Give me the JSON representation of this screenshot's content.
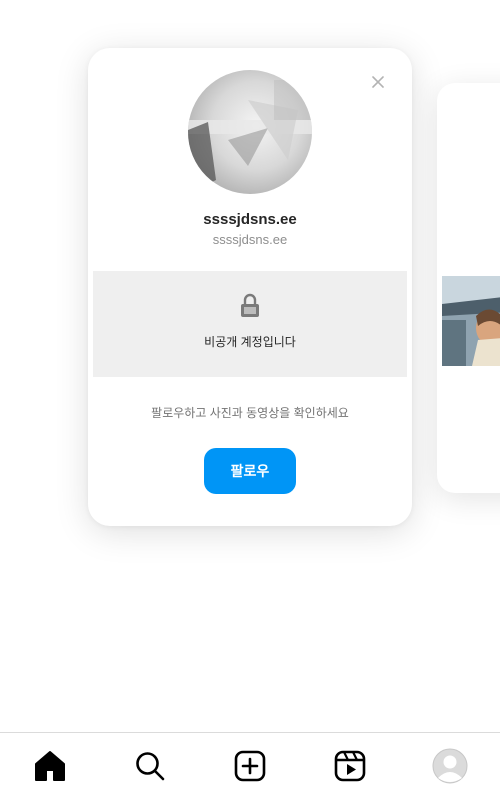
{
  "profile_card": {
    "username": "ssssjdsns.ee",
    "full_name": "ssssjdsns.ee",
    "private_message": "비공개 계정입니다",
    "follow_hint": "팔로우하고 사진과 동영상을 확인하세요",
    "follow_label": "팔로우",
    "dismiss_icon": "close-icon",
    "lock_icon": "lock-icon"
  },
  "bottom_nav": {
    "items": [
      {
        "name": "home",
        "icon": "home-icon",
        "active": true
      },
      {
        "name": "search",
        "icon": "search-icon",
        "active": false
      },
      {
        "name": "create",
        "icon": "plus-square-icon",
        "active": false
      },
      {
        "name": "reels",
        "icon": "reels-icon",
        "active": false
      },
      {
        "name": "profile",
        "icon": "avatar",
        "active": false
      }
    ]
  },
  "colors": {
    "accent": "#0095f6",
    "panel": "#efefef",
    "text": "#262626",
    "muted": "#8e8e8e"
  }
}
